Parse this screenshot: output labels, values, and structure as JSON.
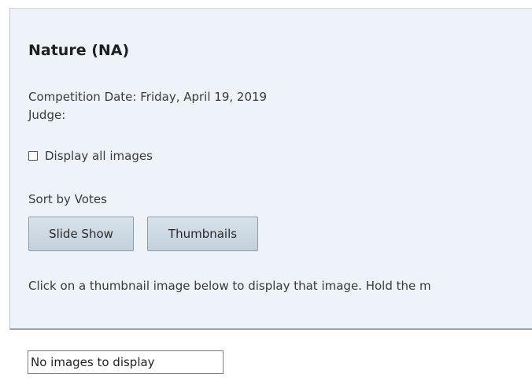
{
  "competition": {
    "title": "Nature (NA)",
    "date_line": "Competition Date: Friday, April 19, 2019",
    "judge_line": "Judge:"
  },
  "options": {
    "display_all_label": "Display all images",
    "display_all_checked": false,
    "sort_label": "Sort by Votes"
  },
  "buttons": {
    "slideshow_label": "Slide Show",
    "thumbnails_label": "Thumbnails"
  },
  "instructions": "Click on a thumbnail image below to display that image. Hold the m",
  "results": {
    "empty_message": "No images to display"
  }
}
